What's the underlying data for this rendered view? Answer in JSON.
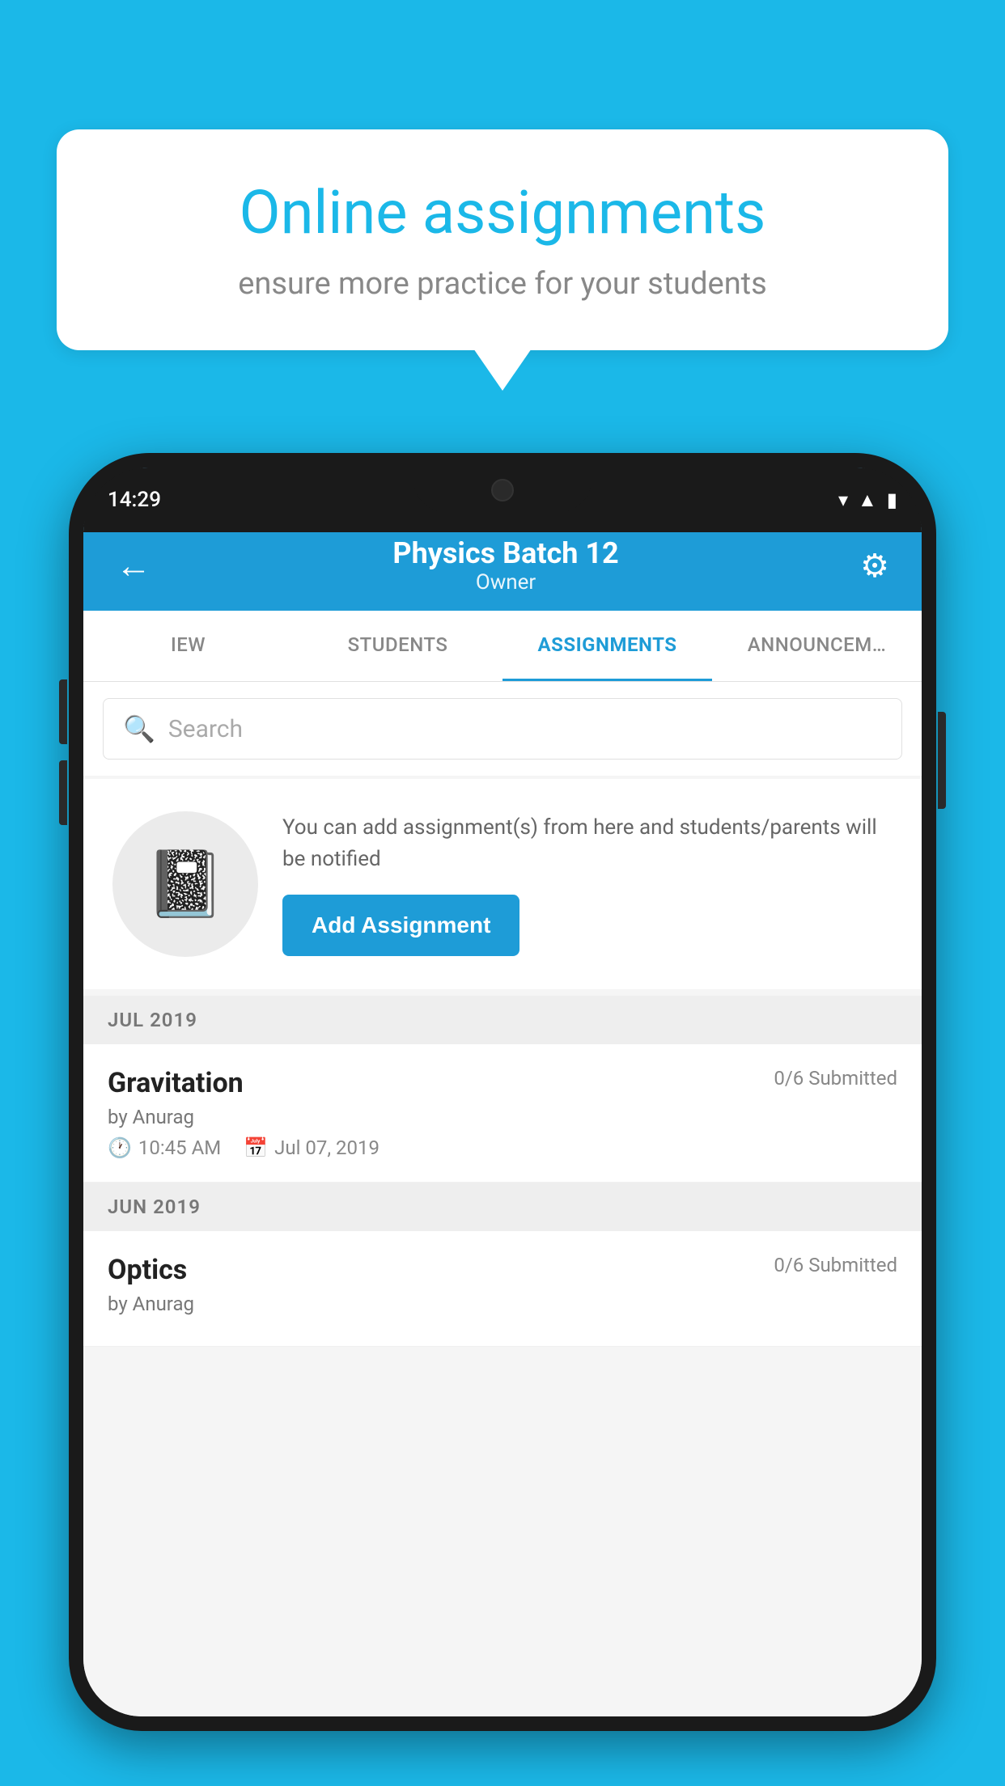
{
  "background_color": "#1bb8e8",
  "speech_bubble": {
    "title": "Online assignments",
    "subtitle": "ensure more practice for your students"
  },
  "phone": {
    "status_bar": {
      "time": "14:29"
    },
    "header": {
      "title": "Physics Batch 12",
      "subtitle": "Owner",
      "back_label": "←",
      "gear_label": "⚙"
    },
    "tabs": [
      {
        "label": "IEW",
        "active": false
      },
      {
        "label": "STUDENTS",
        "active": false
      },
      {
        "label": "ASSIGNMENTS",
        "active": true
      },
      {
        "label": "ANNOUNCEM…",
        "active": false
      }
    ],
    "search": {
      "placeholder": "Search"
    },
    "add_assignment_section": {
      "description": "You can add assignment(s) from here and students/parents will be notified",
      "button_label": "Add Assignment"
    },
    "sections": [
      {
        "header": "JUL 2019",
        "items": [
          {
            "name": "Gravitation",
            "submitted": "0/6 Submitted",
            "author": "by Anurag",
            "time": "10:45 AM",
            "date": "Jul 07, 2019"
          }
        ]
      },
      {
        "header": "JUN 2019",
        "items": [
          {
            "name": "Optics",
            "submitted": "0/6 Submitted",
            "author": "by Anurag",
            "time": "",
            "date": ""
          }
        ]
      }
    ]
  }
}
